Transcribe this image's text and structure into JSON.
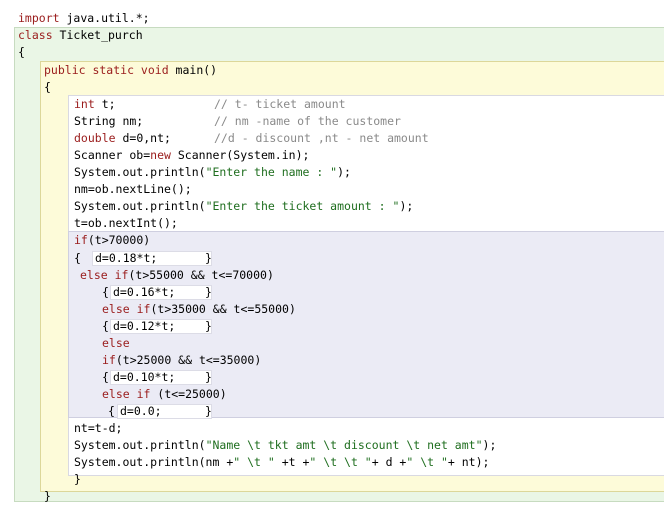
{
  "colors": {
    "keyword": "#9a1c1c",
    "string": "#1f6e1f",
    "comment": "#8a8a8a",
    "class_scope": "#eaf6e6",
    "method_scope": "#fdfbd9",
    "if_scope": "#ebebf5"
  },
  "code": {
    "import_kw": "import",
    "import_rest": " java.util.*;",
    "class_kw": "class",
    "class_name": " Ticket_purch",
    "class_open": "{",
    "method_sig": "public static void",
    "method_name": " main()",
    "method_open": "{",
    "decl1_type": "int",
    "decl1_var": " t;",
    "decl1_comment": "// t- ticket amount",
    "decl2_stmt": "String nm;",
    "decl2_comment": "// nm -name of the customer",
    "decl3_type": "double",
    "decl3_var": " d=0,nt;",
    "decl3_comment": "//d - discount ,nt - net amount",
    "scanner_a": "Scanner ob=",
    "scanner_new": "new",
    "scanner_b": " Scanner(System.in);",
    "print1_a": "System.out.println(",
    "print1_str": "\"Enter the name : \"",
    "print1_b": ");",
    "read_name": "nm=ob.nextLine();",
    "print2_a": "System.out.println(",
    "print2_str": "\"Enter the ticket amount : \"",
    "print2_b": ");",
    "read_amt": "t=ob.nextInt();",
    "if1_kw": "if",
    "if1_cond": "(t>70000)",
    "brace_open": "{",
    "brace_close": "}",
    "stmt1": "d=0.18*t;",
    "else_if1_kw": "else if",
    "else_if1_cond": "(t>55000 && t<=70000)",
    "stmt2": "d=0.16*t;",
    "else_if2_kw": "else if",
    "else_if2_cond": "(t>35000 && t<=55000)",
    "stmt3": "d=0.12*t;",
    "else_kw": "else",
    "if4_kw": "if",
    "if4_cond": "(t>25000 && t<=35000)",
    "stmt4": "d=0.10*t;",
    "else_if3_kw": "else if",
    "else_if3_cond": " (t<=25000)",
    "stmt5": "d=0.0;",
    "net_calc": "nt=t-d;",
    "print3_a": "System.out.println(",
    "print3_str": "\"Name \\t tkt amt \\t discount \\t net amt\"",
    "print3_b": ");",
    "print4_a": "System.out.println(nm +",
    "print4_s1": "\" \\t \"",
    "print4_b": " +t +",
    "print4_s2": "\" \\t \\t \"",
    "print4_c": "+ d +",
    "print4_s3": "\" \\t \"",
    "print4_d": "+ nt);",
    "method_close": "}",
    "class_close": "}"
  }
}
